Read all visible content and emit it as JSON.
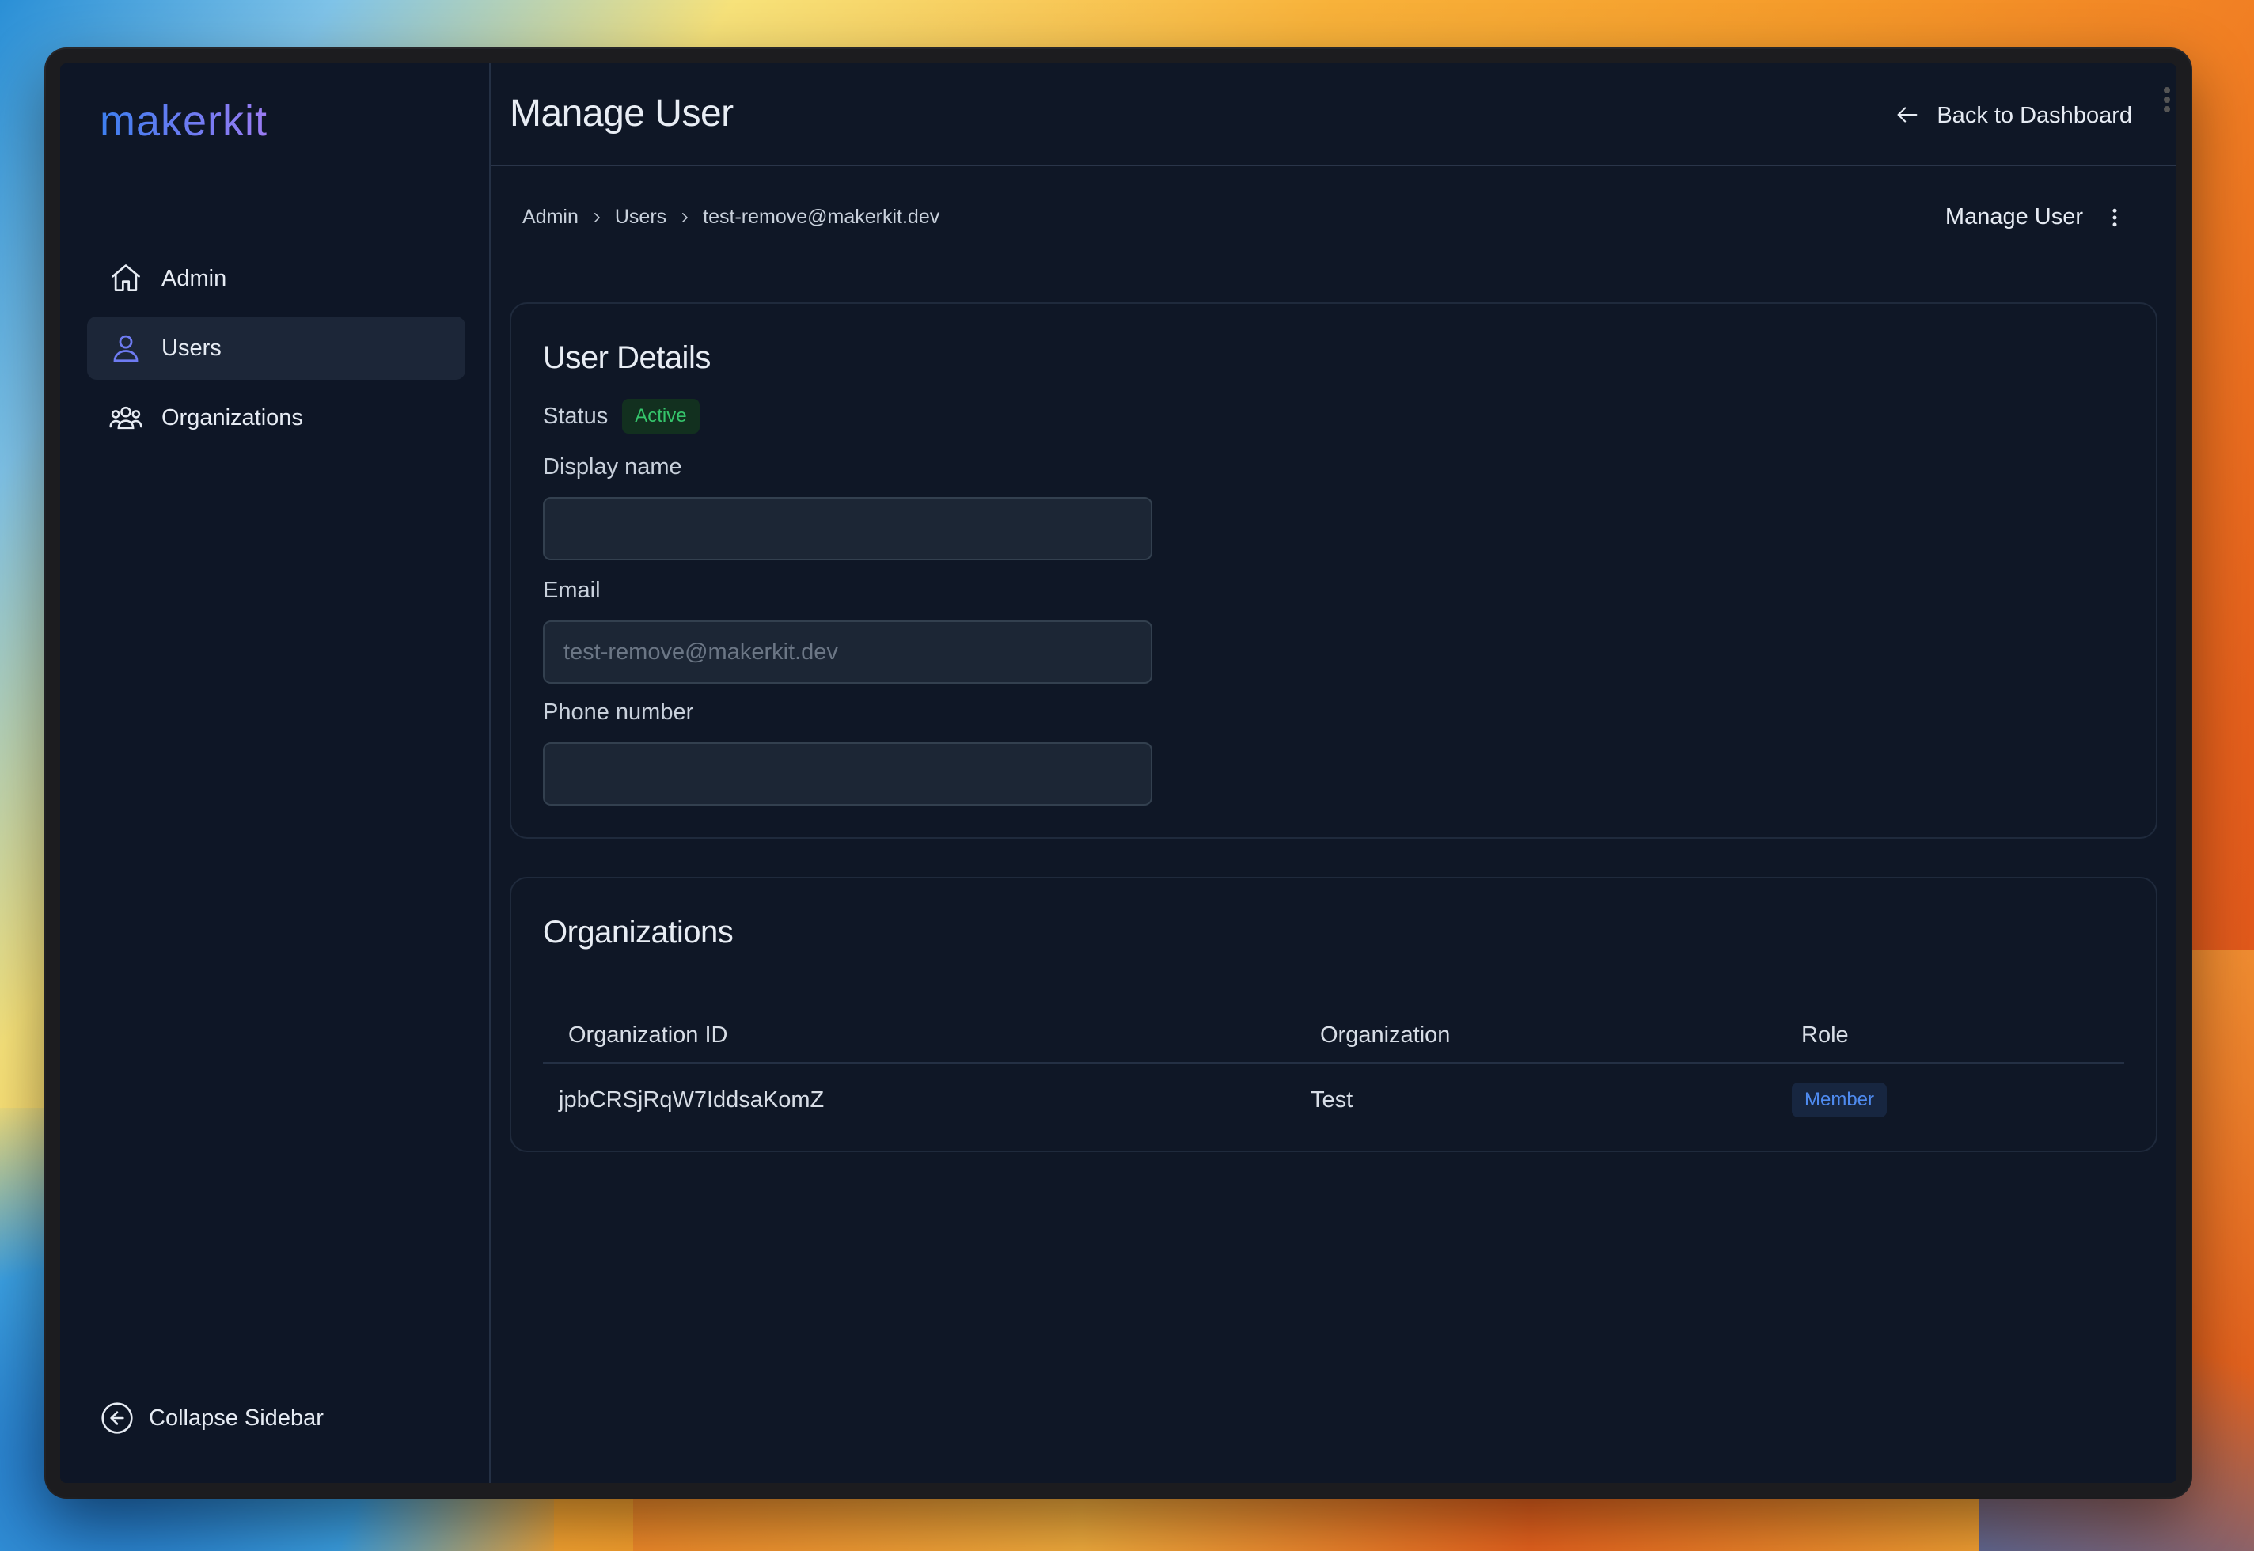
{
  "app": {
    "logo": "makerkit"
  },
  "sidebar": {
    "items": [
      {
        "label": "Admin",
        "icon": "home-icon",
        "active": false
      },
      {
        "label": "Users",
        "icon": "user-icon",
        "active": true
      },
      {
        "label": "Organizations",
        "icon": "users-group-icon",
        "active": false
      }
    ],
    "collapse_label": "Collapse Sidebar"
  },
  "header": {
    "title": "Manage User",
    "back_label": "Back to Dashboard"
  },
  "breadcrumb": [
    "Admin",
    "Users",
    "test-remove@makerkit.dev"
  ],
  "manage_menu_label": "Manage User",
  "user_details": {
    "title": "User Details",
    "status_label": "Status",
    "status_value": "Active",
    "display_name_label": "Display name",
    "display_name_value": "",
    "email_label": "Email",
    "email_placeholder": "test-remove@makerkit.dev",
    "phone_label": "Phone number",
    "phone_value": ""
  },
  "organizations": {
    "title": "Organizations",
    "columns": [
      "Organization ID",
      "Organization",
      "Role"
    ],
    "rows": [
      {
        "id": "jpbCRSjRqW7IddsaKomZ",
        "name": "Test",
        "role": "Member"
      }
    ]
  },
  "colors": {
    "accent": "#6e7bf2",
    "active_badge": "#35c46b",
    "member_badge": "#4f8bf0",
    "background": "#0f1726"
  }
}
